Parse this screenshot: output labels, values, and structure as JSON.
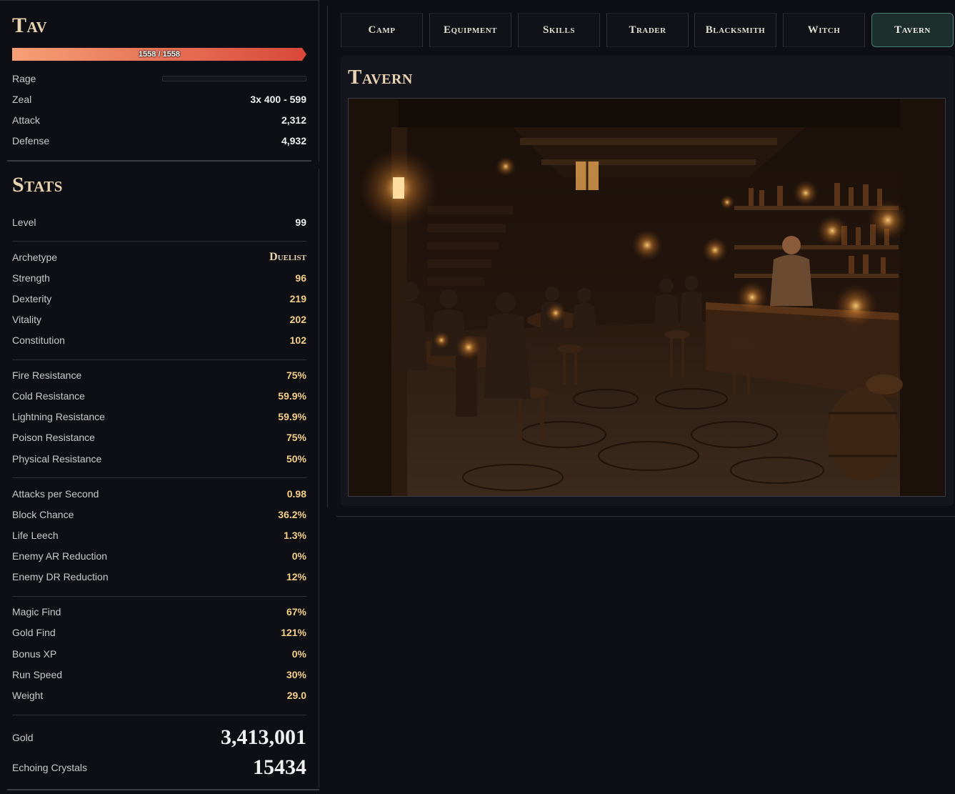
{
  "character": {
    "name": "Tav",
    "hp": {
      "current": 1558,
      "max": 1558,
      "label": "1558 / 1558"
    },
    "rage_label": "Rage",
    "rage_fraction": 0,
    "zeal_label": "Zeal",
    "zeal_value": "3x 400 - 599",
    "attack_label": "Attack",
    "attack_value": "2,312",
    "defense_label": "Defense",
    "defense_value": "4,932"
  },
  "stats": {
    "title": "Stats",
    "level": {
      "label": "Level",
      "value": "99"
    },
    "archetype": {
      "label": "Archetype",
      "value": "Duelist"
    },
    "strength": {
      "label": "Strength",
      "value": "96"
    },
    "dexterity": {
      "label": "Dexterity",
      "value": "219"
    },
    "vitality": {
      "label": "Vitality",
      "value": "202"
    },
    "constitution": {
      "label": "Constitution",
      "value": "102"
    },
    "fire_res": {
      "label": "Fire Resistance",
      "value": "75%"
    },
    "cold_res": {
      "label": "Cold Resistance",
      "value": "59.9%"
    },
    "lightning_res": {
      "label": "Lightning Resistance",
      "value": "59.9%"
    },
    "poison_res": {
      "label": "Poison Resistance",
      "value": "75%"
    },
    "physical_res": {
      "label": "Physical Resistance",
      "value": "50%"
    },
    "aps": {
      "label": "Attacks per Second",
      "value": "0.98"
    },
    "block": {
      "label": "Block Chance",
      "value": "36.2%"
    },
    "leech": {
      "label": "Life Leech",
      "value": "1.3%"
    },
    "enemy_ar": {
      "label": "Enemy AR Reduction",
      "value": "0%"
    },
    "enemy_dr": {
      "label": "Enemy DR Reduction",
      "value": "12%"
    },
    "magic_find": {
      "label": "Magic Find",
      "value": "67%"
    },
    "gold_find": {
      "label": "Gold Find",
      "value": "121%"
    },
    "bonus_xp": {
      "label": "Bonus XP",
      "value": "0%"
    },
    "run_speed": {
      "label": "Run Speed",
      "value": "30%"
    },
    "weight": {
      "label": "Weight",
      "value": "29.0"
    },
    "gold": {
      "label": "Gold",
      "value": "3,413,001"
    },
    "crystals": {
      "label": "Echoing Crystals",
      "value": "15434"
    }
  },
  "tabs": [
    {
      "label": "Camp"
    },
    {
      "label": "Equipment"
    },
    {
      "label": "Skills"
    },
    {
      "label": "Trader"
    },
    {
      "label": "Blacksmith"
    },
    {
      "label": "Witch"
    },
    {
      "label": "Tavern"
    }
  ],
  "active_tab": "Tavern",
  "content": {
    "title": "Tavern"
  },
  "colors": {
    "accent_gold": "#e4b36a",
    "hp_bar": "#e0523f",
    "active_tab": "#1c2f2c"
  }
}
